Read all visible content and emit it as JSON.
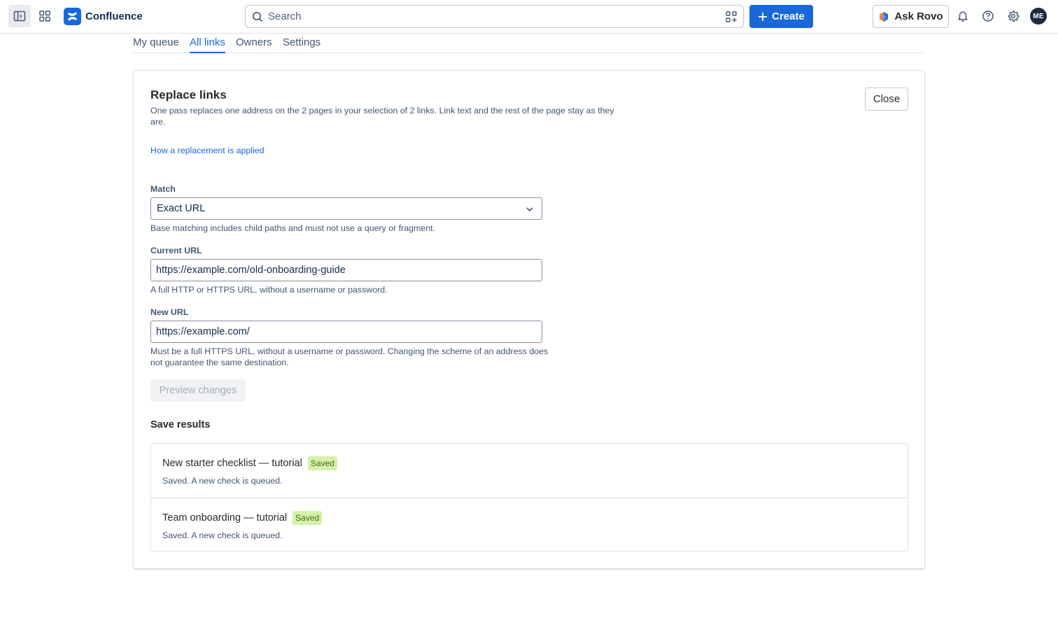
{
  "topbar": {
    "app_name": "Confluence",
    "search_placeholder": "Search",
    "create_label": "Create",
    "rovo_label": "Ask Rovo",
    "avatar_initials": "ME",
    "brand_color": "#1868db"
  },
  "tabs": [
    {
      "label": "My queue",
      "active": false
    },
    {
      "label": "All links",
      "active": true
    },
    {
      "label": "Owners",
      "active": false
    },
    {
      "label": "Settings",
      "active": false
    }
  ],
  "panel": {
    "title": "Replace links",
    "description": "One pass replaces one address on the 2 pages in your selection of 2 links. Link text and the rest of the page stay as they are.",
    "close_label": "Close",
    "help_link": "How a replacement is applied"
  },
  "form": {
    "match": {
      "label": "Match",
      "value": "Exact URL",
      "help": "Base matching includes child paths and must not use a query or fragment."
    },
    "current_url": {
      "label": "Current URL",
      "value": "https://example.com/old-onboarding-guide",
      "help": "A full HTTP or HTTPS URL, without a username or password."
    },
    "new_url": {
      "label": "New URL",
      "value": "https://example.com/",
      "help": "Must be a full HTTPS URL, without a username or password. Changing the scheme of an address does not guarantee the same destination."
    },
    "preview_label": "Preview changes"
  },
  "results": {
    "title": "Save results",
    "items": [
      {
        "page": "New starter checklist — tutorial",
        "badge": "Saved",
        "status": "Saved. A new check is queued."
      },
      {
        "page": "Team onboarding — tutorial",
        "badge": "Saved",
        "status": "Saved. A new check is queued."
      }
    ]
  }
}
